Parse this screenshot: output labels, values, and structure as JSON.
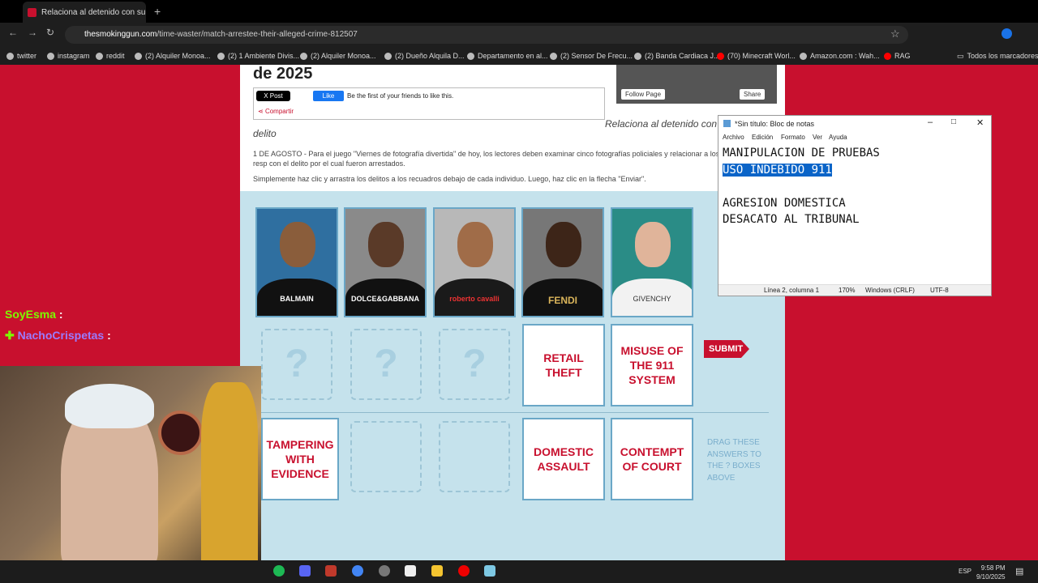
{
  "browser": {
    "tab_title": "Relaciona al detenido con su pr",
    "url_host": "thesmokinggun.com",
    "url_path": "/time-waster/match-arrestee-their-alleged-crime-812507",
    "bookmarks": [
      "twitter",
      "instagram",
      "reddit",
      "(2) Alquiler Monoa...",
      "(2) 1 Ambiente Divis...",
      "(2) Alquiler Monoa...",
      "(2) Dueño Alquila D...",
      "Departamento en al...",
      "(2) Sensor De Frecu...",
      "(2) Banda Cardiaca J...",
      "(70) Minecraft Worl...",
      "Amazon.com : Wah...",
      "RAG"
    ],
    "all_bookmarks": "Todos los marcadores"
  },
  "page": {
    "heading": "de 2025",
    "x_post": "X Post",
    "fb_like": "Like",
    "fb_text": "Be the first of your friends to like this.",
    "share": "Compartir",
    "follow": "Follow Page",
    "share_fb": "Share",
    "relaciona": "Relaciona al detenido con",
    "delito": "delito",
    "p1": "1 DE AGOSTO - Para el juego \"Viernes de fotografía divertida\" de hoy, los lectores deben examinar cinco fotografías policiales y relacionar a los resp con el delito por el cual fueron arrestados.",
    "p2": "Simplemente haz clic y arrastra los delitos a los recuadros debajo de cada individuo. Luego, haz clic en la flecha \"Enviar\"."
  },
  "mugshots": [
    {
      "brand": "BALMAIN"
    },
    {
      "brand": "DOLCE&GABBANA"
    },
    {
      "brand": "roberto cavalli"
    },
    {
      "brand": "FENDI"
    },
    {
      "brand": "GIVENCHY"
    }
  ],
  "placed_answers": [
    "RETAIL THEFT",
    "MISUSE OF THE 911 SYSTEM"
  ],
  "pool_answers": [
    "TAMPERING WITH EVIDENCE",
    "DOMESTIC ASSAULT",
    "CONTEMPT OF COURT"
  ],
  "drop_placeholder": "?",
  "submit": "SUBMIT",
  "hint": "DRAG THESE ANSWERS TO THE ? BOXES ABOVE",
  "notepad": {
    "title": "*Sin título: Bloc de notas",
    "menu": [
      "Archivo",
      "Edición",
      "Formato",
      "Ver",
      "Ayuda"
    ],
    "line1": "MANIPULACION DE PRUEBAS",
    "line2": "USO INDEBIDO 911",
    "line3": "",
    "line4": "AGRESION DOMESTICA",
    "line5": "DESACATO AL TRIBUNAL",
    "status_pos": "Línea 2, columna 1",
    "status_zoom": "170%",
    "status_eol": "Windows (CRLF)",
    "status_enc": "UTF-8"
  },
  "chat": [
    {
      "user": "SoyEsma",
      "color": "#7CFC00"
    },
    {
      "user": "NachoCrispetas",
      "color": "#9b7bff"
    }
  ],
  "taskbar": {
    "lang": "ESP",
    "time": "9:58 PM",
    "date": "9/10/2025"
  }
}
